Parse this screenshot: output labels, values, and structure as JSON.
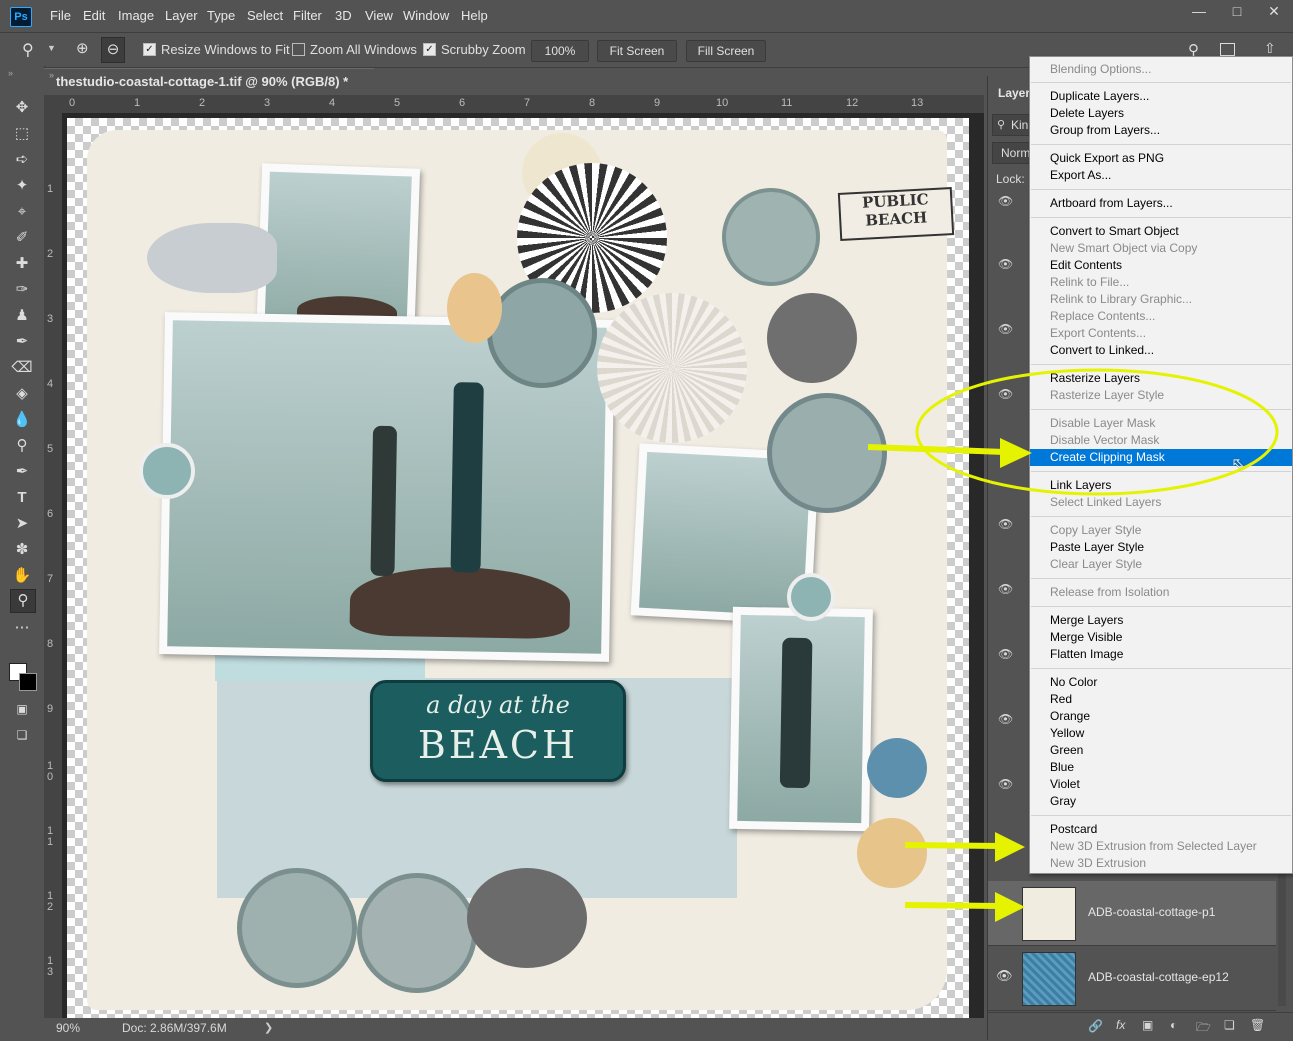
{
  "app": {
    "logo": "Ps"
  },
  "menubar": {
    "items": [
      "File",
      "Edit",
      "Image",
      "Layer",
      "Type",
      "Select",
      "Filter",
      "3D",
      "View",
      "Window",
      "Help"
    ],
    "window_controls": [
      "minimize-icon",
      "maximize-icon",
      "close-icon"
    ]
  },
  "options": {
    "zoom_icon": "zoom-icon",
    "resize_windows": {
      "label": "Resize Windows to Fit",
      "checked": true
    },
    "zoom_all": {
      "label": "Zoom All Windows",
      "checked": false
    },
    "scrubby": {
      "label": "Scrubby Zoom",
      "checked": true
    },
    "zoom_level": "100%",
    "fit_screen": "Fit Screen",
    "fill_screen": "Fill Screen"
  },
  "document": {
    "tab_title": "thestudio-coastal-cottage-1.tif @ 90% (RGB/8) *",
    "ruler_top": [
      "0",
      "1",
      "2",
      "3",
      "4",
      "5",
      "6",
      "7",
      "8",
      "9",
      "10",
      "11",
      "12",
      "13"
    ],
    "ruler_left": [
      "1",
      "2",
      "3",
      "4",
      "5",
      "6",
      "7",
      "8",
      "9",
      "1\n0",
      "1\n1",
      "1\n2",
      "1\n3"
    ],
    "art_text": {
      "sign_line1": "PUBLIC",
      "sign_line2": "BEACH",
      "title_line1": "a day at the",
      "title_line2": "BEACH"
    }
  },
  "status": {
    "zoom": "90%",
    "doc": "Doc: 2.86M/397.6M"
  },
  "layers_panel": {
    "tab": "Layer",
    "filter_placeholder": "Kin",
    "blend_mode": "Norm",
    "lock_label": "Lock:",
    "rows": [
      {
        "name": "ADB-coastal-cottage-p1",
        "selected": true
      },
      {
        "name": "ADB-coastal-cottage-ep12",
        "selected": false
      }
    ]
  },
  "context_menu": {
    "groups": [
      [
        {
          "label": "Blending Options...",
          "enabled": false
        }
      ],
      [
        {
          "label": "Duplicate Layers...",
          "enabled": true
        },
        {
          "label": "Delete Layers",
          "enabled": true
        },
        {
          "label": "Group from Layers...",
          "enabled": true
        }
      ],
      [
        {
          "label": "Quick Export as PNG",
          "enabled": true
        },
        {
          "label": "Export As...",
          "enabled": true
        }
      ],
      [
        {
          "label": "Artboard from Layers...",
          "enabled": true
        }
      ],
      [
        {
          "label": "Convert to Smart Object",
          "enabled": true
        },
        {
          "label": "New Smart Object via Copy",
          "enabled": false
        },
        {
          "label": "Edit Contents",
          "enabled": true
        },
        {
          "label": "Relink to File...",
          "enabled": false
        },
        {
          "label": "Relink to Library Graphic...",
          "enabled": false
        },
        {
          "label": "Replace Contents...",
          "enabled": false
        },
        {
          "label": "Export Contents...",
          "enabled": false
        },
        {
          "label": "Convert to Linked...",
          "enabled": true
        }
      ],
      [
        {
          "label": "Rasterize Layers",
          "enabled": true
        },
        {
          "label": "Rasterize Layer Style",
          "enabled": false
        }
      ],
      [
        {
          "label": "Disable Layer Mask",
          "enabled": false
        },
        {
          "label": "Disable Vector Mask",
          "enabled": false
        },
        {
          "label": "Create Clipping Mask",
          "enabled": true,
          "highlighted": true
        }
      ],
      [
        {
          "label": "Link Layers",
          "enabled": true
        },
        {
          "label": "Select Linked Layers",
          "enabled": false
        }
      ],
      [
        {
          "label": "Copy Layer Style",
          "enabled": false
        },
        {
          "label": "Paste Layer Style",
          "enabled": true
        },
        {
          "label": "Clear Layer Style",
          "enabled": false
        }
      ],
      [
        {
          "label": "Release from Isolation",
          "enabled": false
        }
      ],
      [
        {
          "label": "Merge Layers",
          "enabled": true
        },
        {
          "label": "Merge Visible",
          "enabled": true
        },
        {
          "label": "Flatten Image",
          "enabled": true
        }
      ],
      [
        {
          "label": "No Color",
          "enabled": true
        },
        {
          "label": "Red",
          "enabled": true
        },
        {
          "label": "Orange",
          "enabled": true
        },
        {
          "label": "Yellow",
          "enabled": true
        },
        {
          "label": "Green",
          "enabled": true
        },
        {
          "label": "Blue",
          "enabled": true
        },
        {
          "label": "Violet",
          "enabled": true
        },
        {
          "label": "Gray",
          "enabled": true
        }
      ],
      [
        {
          "label": "Postcard",
          "enabled": true
        },
        {
          "label": "New 3D Extrusion from Selected Layer",
          "enabled": false
        },
        {
          "label": "New 3D Extrusion",
          "enabled": false
        }
      ]
    ]
  },
  "colors": {
    "highlight": "#0078d7",
    "annotation": "#e5f200"
  }
}
